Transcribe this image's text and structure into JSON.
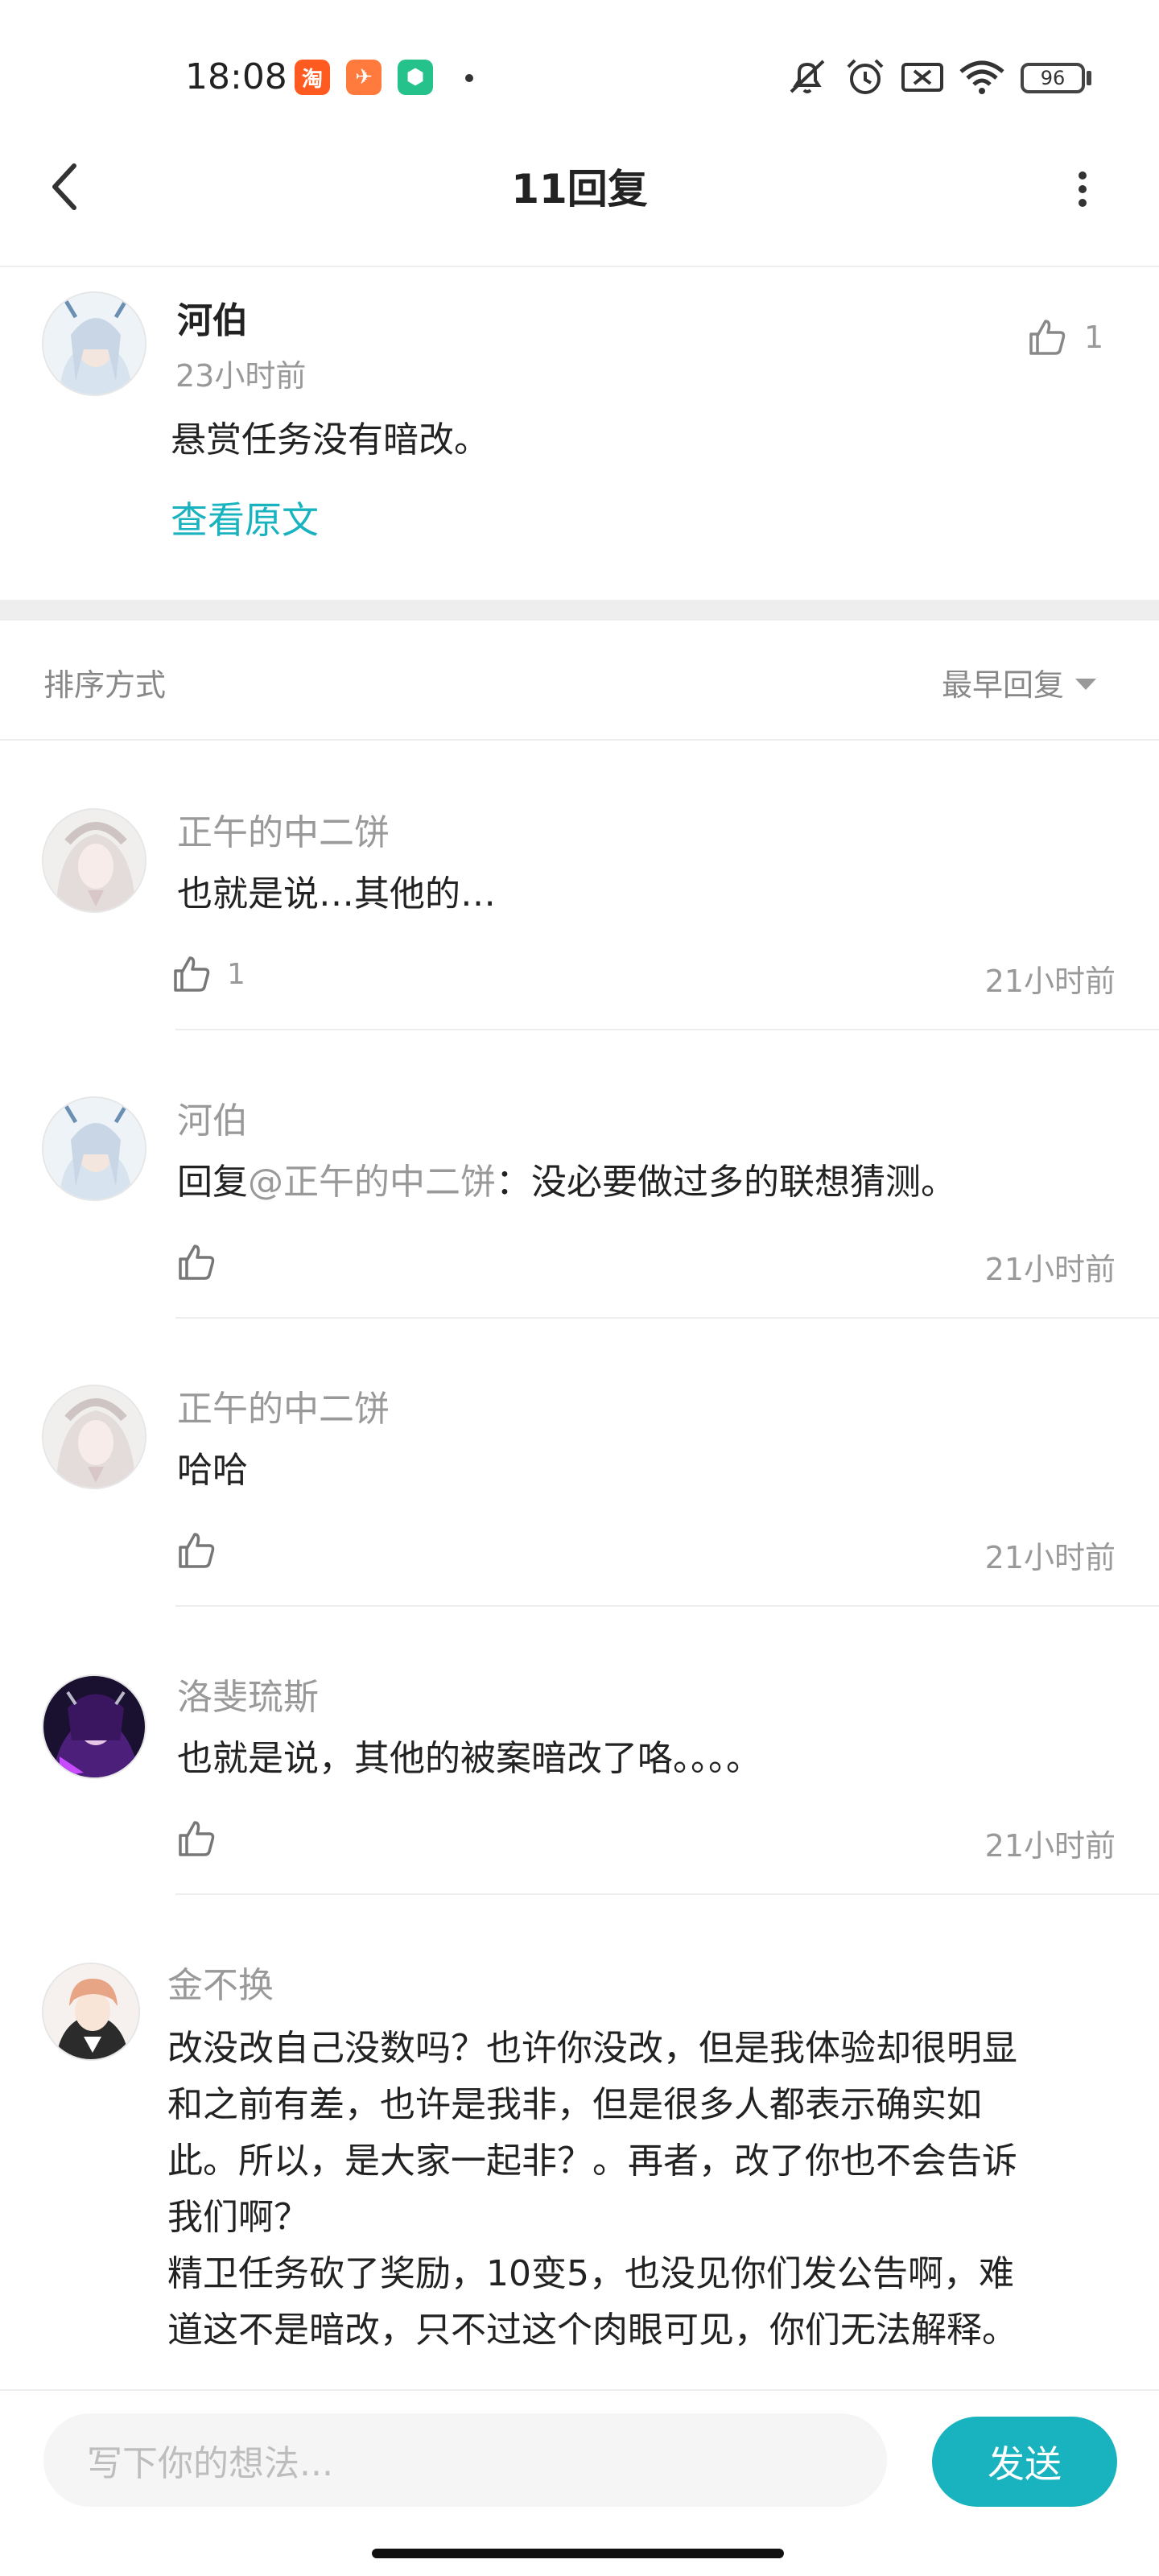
{
  "status_bar": {
    "time": "18:08",
    "app_icons": [
      {
        "name": "taobao-app-icon",
        "glyph": "淘",
        "color": "#ff5a1f"
      },
      {
        "name": "bird-app-icon",
        "glyph": "✈",
        "color": "#ff7a3d"
      },
      {
        "name": "shield-app-icon",
        "glyph": "⬢",
        "color": "#25c28c"
      }
    ],
    "battery": "96",
    "icons": [
      "bell-off-icon",
      "alarm-icon",
      "signal-off-icon",
      "wifi-icon",
      "battery-icon"
    ]
  },
  "nav": {
    "title": "11回复",
    "back_icon": "chevron-left-icon",
    "more_icon": "more-vertical-icon"
  },
  "original_post": {
    "author": "河伯",
    "time": "23小时前",
    "content": "悬赏任务没有暗改。",
    "link": "查看原文",
    "likes": "1"
  },
  "sort": {
    "label": "排序方式",
    "value": "最早回复"
  },
  "replies": [
    {
      "author": "正午的中二饼",
      "content": "也就是说…其他的…",
      "likes": "1",
      "time": "21小时前"
    },
    {
      "author": "河伯",
      "content_prefix": "回复",
      "mention": "@正午的中二饼",
      "content": "：没必要做过多的联想猜测。",
      "likes": "",
      "time": "21小时前"
    },
    {
      "author": "正午的中二饼",
      "content": "哈哈",
      "likes": "",
      "time": "21小时前"
    },
    {
      "author": "洛斐琉斯",
      "content": "也就是说，其他的被案暗改了咯。。。。",
      "likes": "",
      "time": "21小时前"
    },
    {
      "author": "金不换",
      "content": "改没改自己没数吗？也许你没改，但是我体验却很明显\n和之前有差，也许是我非，但是很多人都表示确实如\n此。所以，是大家一起非？。再者，改了你也不会告诉\n我们啊？\n精卫任务砍了奖励，10变5，也没见你们发公告啊，难\n道这不是暗改，只不过这个肉眼可见，你们无法解释。",
      "likes": "",
      "time": ""
    }
  ],
  "composer": {
    "placeholder": "写下你的想法...",
    "send_label": "发送"
  },
  "colors": {
    "accent": "#19b3bf",
    "secondary_text": "#999999",
    "divider": "#eeeeee"
  }
}
